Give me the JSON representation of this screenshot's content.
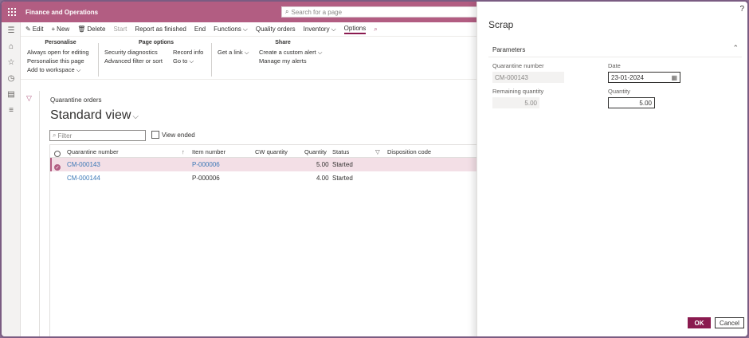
{
  "app": {
    "title": "Finance and Operations"
  },
  "search": {
    "placeholder": "Search for a page"
  },
  "actions": [
    {
      "label": "Edit",
      "icon": "pencil-icon"
    },
    {
      "label": "New",
      "icon": "plus-icon"
    },
    {
      "label": "Delete",
      "icon": "trash-icon"
    },
    {
      "label": "Start"
    },
    {
      "label": "Report as finished"
    },
    {
      "label": "End"
    },
    {
      "label": "Functions"
    },
    {
      "label": "Quality orders"
    },
    {
      "label": "Inventory"
    },
    {
      "label": "Options"
    }
  ],
  "ribbon": {
    "personalise": {
      "header": "Personalise",
      "items": [
        "Always open for editing",
        "Personalise this page",
        "Add to workspace"
      ]
    },
    "page_options": {
      "header": "Page options",
      "col1": [
        "Security diagnostics",
        "Advanced filter or sort"
      ],
      "col2": [
        "Record info",
        "Go to"
      ]
    },
    "share": {
      "header": "Share",
      "col1": [
        "Get a link"
      ],
      "col2": [
        "Create a custom alert",
        "Manage my alerts"
      ]
    }
  },
  "main": {
    "breadcrumb": "Quarantine orders",
    "view_title": "Standard view",
    "filter_placeholder": "Filter",
    "view_ended_label": "View ended"
  },
  "grid": {
    "columns": [
      "Quarantine number",
      "Item number",
      "CW quantity",
      "Quantity",
      "Status",
      "Disposition code"
    ],
    "rows": [
      {
        "quarantine": "CM-000143",
        "item": "P-000006",
        "cw": "",
        "qty": "5.00",
        "status": "Started",
        "disposition": ""
      },
      {
        "quarantine": "CM-000144",
        "item": "P-000006",
        "cw": "",
        "qty": "4.00",
        "status": "Started",
        "disposition": ""
      }
    ]
  },
  "dialog": {
    "help": "?",
    "title": "Scrap",
    "section": "Parameters",
    "quarantine_label": "Quarantine number",
    "quarantine_value": "CM-000143",
    "remaining_label": "Remaining quantity",
    "remaining_value": "5.00",
    "date_label": "Date",
    "date_value": "23-01-2024",
    "quantity_label": "Quantity",
    "quantity_value": "5.00",
    "ok_label": "OK",
    "cancel_label": "Cancel"
  },
  "colors": {
    "accent": "#b25d82",
    "primary_button": "#8a1a4f",
    "link": "#3b78b6"
  }
}
